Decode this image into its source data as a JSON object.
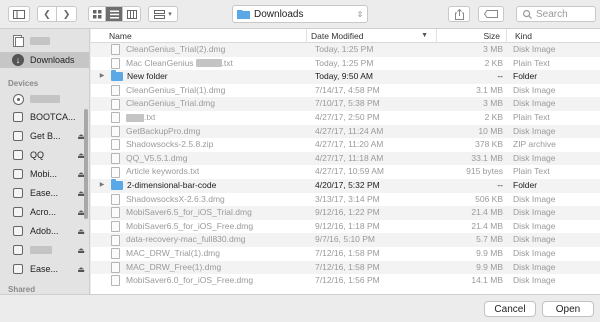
{
  "toolbar": {
    "sidebar_toggle_icon": "sidebar-icon",
    "back_icon": "chevron-left-icon",
    "forward_icon": "chevron-right-icon",
    "view_icons": [
      "grid-icon",
      "list-icon",
      "columns-icon"
    ],
    "arrange_icon": "arrange-icon",
    "location": "Downloads",
    "share_icon": "share-icon",
    "tag_icon": "tag-icon",
    "search_placeholder": "Search"
  },
  "sidebar": {
    "downloads_label": "Downloads",
    "devices_heading": "Devices",
    "shared_heading": "Shared",
    "devices": [
      {
        "label": "BOOTCA...",
        "eject": false
      },
      {
        "label": "Get B...",
        "eject": true
      },
      {
        "label": "QQ",
        "eject": true
      },
      {
        "label": "Mobi...",
        "eject": true
      },
      {
        "label": "Ease...",
        "eject": true
      },
      {
        "label": "Acro...",
        "eject": true
      },
      {
        "label": "Adob...",
        "eject": true
      },
      {
        "label": "",
        "eject": true
      },
      {
        "label": "Ease...",
        "eject": true
      }
    ]
  },
  "columns": {
    "name": "Name",
    "date": "Date Modified",
    "size": "Size",
    "kind": "Kind"
  },
  "files": [
    {
      "name": "CleanGenius_Trial(2).dmg",
      "date": "Today, 1:25 PM",
      "size": "3 MB",
      "kind": "Disk Image",
      "folder": false
    },
    {
      "name": "Mac CleanGenius",
      "suffix": ".txt",
      "date": "Today, 1:25 PM",
      "size": "2 KB",
      "kind": "Plain Text",
      "folder": false
    },
    {
      "name": "New folder",
      "date": "Today, 9:50 AM",
      "size": "--",
      "kind": "Folder",
      "folder": true
    },
    {
      "name": "CleanGenius_Trial(1).dmg",
      "date": "7/14/17, 4:58 PM",
      "size": "3.1 MB",
      "kind": "Disk Image",
      "folder": false
    },
    {
      "name": "CleanGenius_Trial.dmg",
      "date": "7/10/17, 5:38 PM",
      "size": "3 MB",
      "kind": "Disk Image",
      "folder": false
    },
    {
      "name": "",
      "suffix": ".txt",
      "date": "4/27/17, 2:50 PM",
      "size": "2 KB",
      "kind": "Plain Text",
      "folder": false
    },
    {
      "name": "GetBackupPro.dmg",
      "date": "4/27/17, 11:24 AM",
      "size": "10 MB",
      "kind": "Disk Image",
      "folder": false
    },
    {
      "name": "Shadowsocks-2.5.8.zip",
      "date": "4/27/17, 11:20 AM",
      "size": "378 KB",
      "kind": "ZIP archive",
      "folder": false
    },
    {
      "name": "QQ_V5.5.1.dmg",
      "date": "4/27/17, 11:18 AM",
      "size": "33.1 MB",
      "kind": "Disk Image",
      "folder": false
    },
    {
      "name": "Article keywords.txt",
      "date": "4/27/17, 10:59 AM",
      "size": "915 bytes",
      "kind": "Plain Text",
      "folder": false
    },
    {
      "name": "2-dimensional-bar-code",
      "date": "4/20/17, 5:32 PM",
      "size": "--",
      "kind": "Folder",
      "folder": true
    },
    {
      "name": "ShadowsocksX-2.6.3.dmg",
      "date": "3/13/17, 3:14 PM",
      "size": "506 KB",
      "kind": "Disk Image",
      "folder": false
    },
    {
      "name": "MobiSaver6.5_for_iOS_Trial.dmg",
      "date": "9/12/16, 1:22 PM",
      "size": "21.4 MB",
      "kind": "Disk Image",
      "folder": false
    },
    {
      "name": "MobiSaver6.5_for_iOS_Free.dmg",
      "date": "9/12/16, 1:18 PM",
      "size": "21.4 MB",
      "kind": "Disk Image",
      "folder": false
    },
    {
      "name": "data-recovery-mac_full830.dmg",
      "date": "9/7/16, 5:10 PM",
      "size": "5.7 MB",
      "kind": "Disk Image",
      "folder": false
    },
    {
      "name": "MAC_DRW_Trial(1).dmg",
      "date": "7/12/16, 1:58 PM",
      "size": "9.9 MB",
      "kind": "Disk Image",
      "folder": false
    },
    {
      "name": "MAC_DRW_Free(1).dmg",
      "date": "7/12/16, 1:58 PM",
      "size": "9.9 MB",
      "kind": "Disk Image",
      "folder": false
    },
    {
      "name": "MobiSaver6.0_for_iOS_Free.dmg",
      "date": "7/12/16, 1:56 PM",
      "size": "14.1 MB",
      "kind": "Disk Image",
      "folder": false
    }
  ],
  "buttons": {
    "cancel": "Cancel",
    "open": "Open"
  }
}
